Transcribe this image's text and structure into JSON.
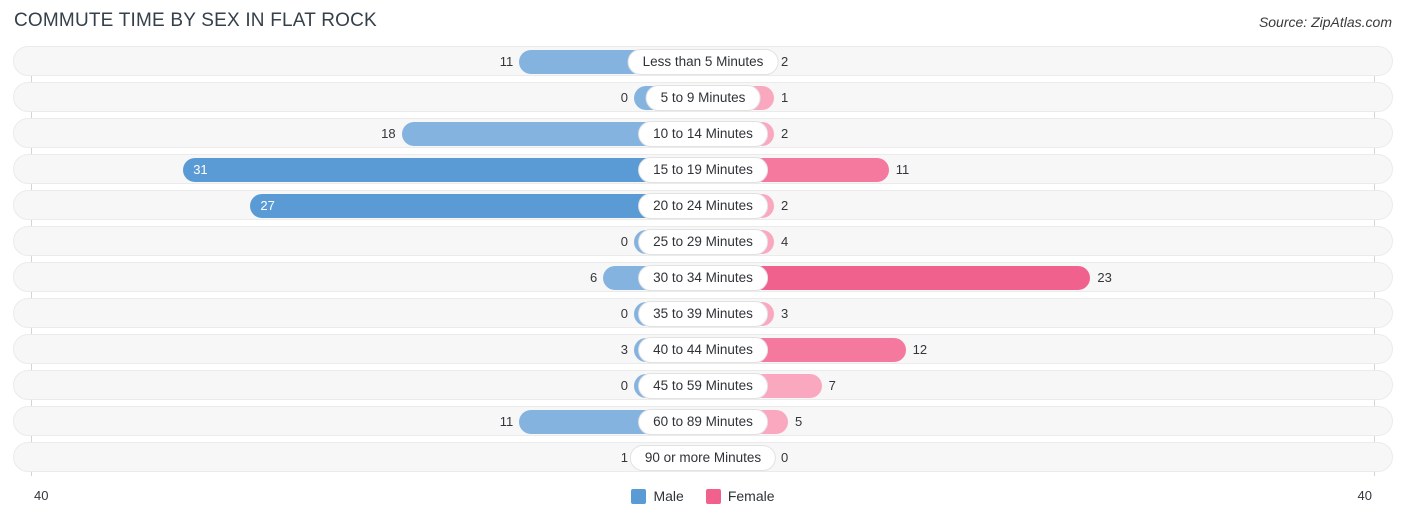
{
  "header": {
    "title": "COMMUTE TIME BY SEX IN FLAT ROCK",
    "source": "Source: ZipAtlas.com"
  },
  "axis": {
    "min_label": "40",
    "max_label": "40",
    "max_value": 40
  },
  "legend": [
    {
      "label": "Male",
      "color": "#5b9bd5",
      "key": "male"
    },
    {
      "label": "Female",
      "color": "#f0628d",
      "key": "female"
    }
  ],
  "colors": {
    "male_light": "#85b3e0",
    "male_dark": "#5b9bd5",
    "female_light": "#f9a8c0",
    "female_mid": "#f5789f",
    "female_dark": "#f0628d",
    "row_background": "#f7f7f7",
    "row_border": "#ebebeb",
    "axis_line": "#d4d4d4",
    "title": "#36404a"
  },
  "chart_data": {
    "type": "bar",
    "orientation": "horizontal",
    "layout": "diverging-bidirectional",
    "title": "COMMUTE TIME BY SEX IN FLAT ROCK",
    "xlabel": "",
    "ylabel": "",
    "xlim": [
      40,
      40
    ],
    "grid": false,
    "legend_position": "bottom-center",
    "categories": [
      "Less than 5 Minutes",
      "5 to 9 Minutes",
      "10 to 14 Minutes",
      "15 to 19 Minutes",
      "20 to 24 Minutes",
      "25 to 29 Minutes",
      "30 to 34 Minutes",
      "35 to 39 Minutes",
      "40 to 44 Minutes",
      "45 to 59 Minutes",
      "60 to 89 Minutes",
      "90 or more Minutes"
    ],
    "series": [
      {
        "name": "Male",
        "values": [
          11,
          0,
          18,
          31,
          27,
          0,
          6,
          0,
          3,
          0,
          11,
          1
        ]
      },
      {
        "name": "Female",
        "values": [
          2,
          1,
          2,
          11,
          2,
          4,
          23,
          3,
          12,
          7,
          5,
          0
        ]
      }
    ]
  },
  "rows": [
    {
      "category": "Less than 5 Minutes",
      "male": "11",
      "female": "2",
      "male_value": 11,
      "female_value": 2
    },
    {
      "category": "5 to 9 Minutes",
      "male": "0",
      "female": "1",
      "male_value": 0,
      "female_value": 1
    },
    {
      "category": "10 to 14 Minutes",
      "male": "18",
      "female": "2",
      "male_value": 18,
      "female_value": 2
    },
    {
      "category": "15 to 19 Minutes",
      "male": "31",
      "female": "11",
      "male_value": 31,
      "female_value": 11
    },
    {
      "category": "20 to 24 Minutes",
      "male": "27",
      "female": "2",
      "male_value": 27,
      "female_value": 2
    },
    {
      "category": "25 to 29 Minutes",
      "male": "0",
      "female": "4",
      "male_value": 0,
      "female_value": 4
    },
    {
      "category": "30 to 34 Minutes",
      "male": "6",
      "female": "23",
      "male_value": 6,
      "female_value": 23
    },
    {
      "category": "35 to 39 Minutes",
      "male": "0",
      "female": "3",
      "male_value": 0,
      "female_value": 3
    },
    {
      "category": "40 to 44 Minutes",
      "male": "3",
      "female": "12",
      "male_value": 3,
      "female_value": 12
    },
    {
      "category": "45 to 59 Minutes",
      "male": "0",
      "female": "7",
      "male_value": 0,
      "female_value": 7
    },
    {
      "category": "60 to 89 Minutes",
      "male": "11",
      "female": "5",
      "male_value": 11,
      "female_value": 5
    },
    {
      "category": "90 or more Minutes",
      "male": "1",
      "female": "0",
      "male_value": 1,
      "female_value": 0
    }
  ]
}
